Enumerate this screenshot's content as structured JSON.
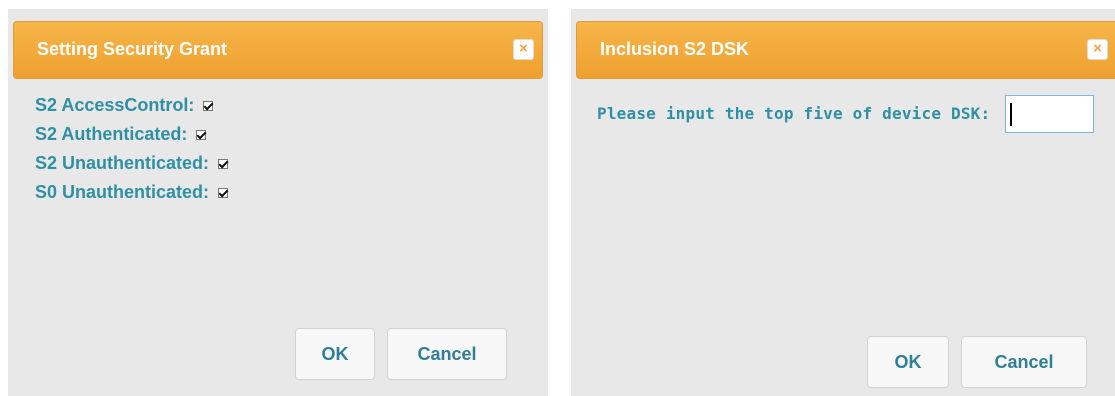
{
  "grant_dialog": {
    "title": "Setting Security Grant",
    "close_icon": "×",
    "items": [
      {
        "label": "S2 AccessControl:",
        "checked": true
      },
      {
        "label": "S2 Authenticated:",
        "checked": true
      },
      {
        "label": "S2 Unauthenticated:",
        "checked": true
      },
      {
        "label": "S0 Unauthenticated:",
        "checked": true
      }
    ],
    "ok_label": "OK",
    "cancel_label": "Cancel"
  },
  "dsk_dialog": {
    "title": "Inclusion S2 DSK",
    "close_icon": "×",
    "prompt": "Please input the top five of device DSK:",
    "input_value": "",
    "ok_label": "OK",
    "cancel_label": "Cancel"
  },
  "colors": {
    "titlebar": "#f0a63a",
    "dialog_bg": "#e8e8e8",
    "label_text": "#2f8fa4",
    "button_text": "#2f7f97"
  }
}
